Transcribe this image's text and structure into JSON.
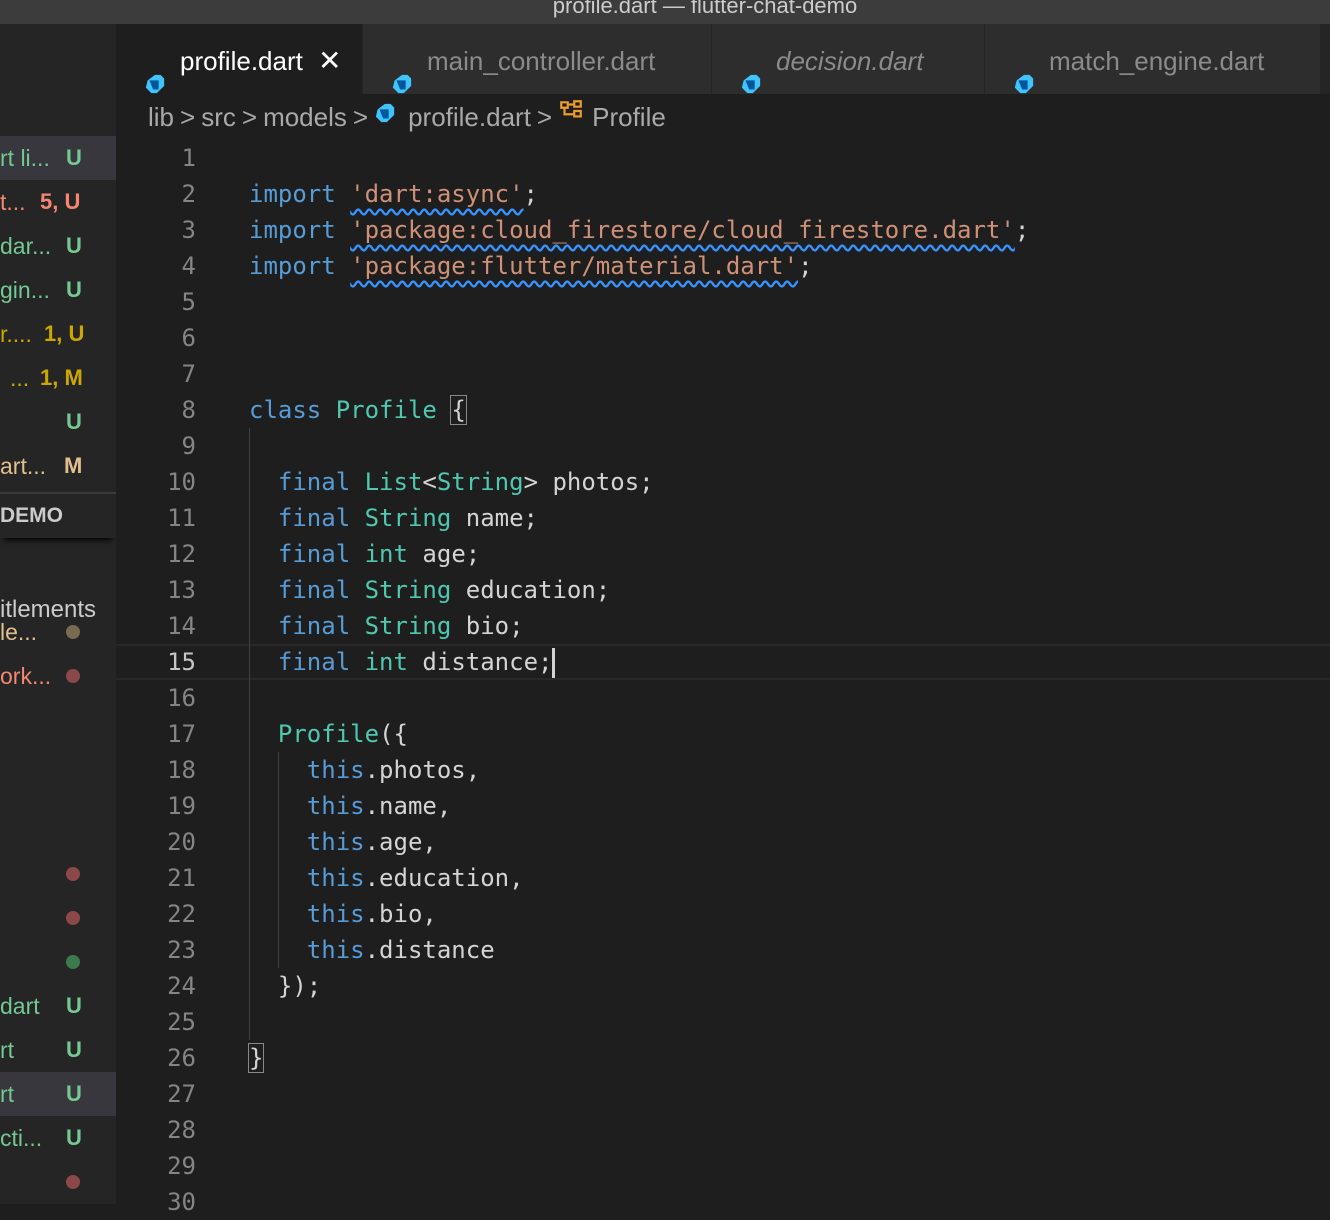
{
  "window": {
    "title": "profile.dart — flutter-chat-demo"
  },
  "colors": {
    "keyword": "#569cd6",
    "type": "#4ec9b0",
    "string": "#ce9178",
    "text": "#d4d4d4",
    "untracked": "#73c991",
    "modified": "#e2c08d",
    "error": "#f48771"
  },
  "sidebar": {
    "items": [
      {
        "name": "rt li...",
        "badge": "U",
        "color": "#73c991"
      },
      {
        "name": "t...",
        "badge": "5, U",
        "color": "#f48771"
      },
      {
        "name": "dar...",
        "badge": "U",
        "color": "#73c991"
      },
      {
        "name": "gin...",
        "badge": "U",
        "color": "#73c991"
      },
      {
        "name": "r....",
        "badge": "1, U",
        "color": "#cca700"
      },
      {
        "name": "...",
        "badge": "1, M",
        "color": "#cca700"
      },
      {
        "name": "",
        "badge": "U",
        "color": "#73c991"
      },
      {
        "name": "art...",
        "badge": "M",
        "color": "#e2c08d"
      }
    ],
    "section_header": "DEMO",
    "entitlements": "itlements",
    "dot_items": [
      {
        "name": "le...",
        "color": "#7a6a50"
      },
      {
        "name": "ork...",
        "color": "#8c4848"
      }
    ],
    "bottom_items": [
      {
        "name": "dart",
        "badge": "U"
      },
      {
        "name": "rt",
        "badge": "U"
      },
      {
        "name": "rt",
        "badge": "U"
      },
      {
        "name": "cti...",
        "badge": "U"
      }
    ]
  },
  "tabs": [
    {
      "label": "profile.dart",
      "close": "✕"
    },
    {
      "label": "main_controller.dart"
    },
    {
      "label": "decision.dart"
    },
    {
      "label": "match_engine.dart"
    }
  ],
  "breadcrumb": {
    "items": [
      "lib",
      "src",
      "models",
      "profile.dart",
      "Profile"
    ],
    "separator": ">"
  },
  "editor": {
    "lines": [
      [],
      [
        [
          "kw",
          "import"
        ],
        [
          "txt",
          " "
        ],
        [
          "str",
          "'dart:async'"
        ],
        [
          "txt",
          ";"
        ]
      ],
      [
        [
          "kw",
          "import"
        ],
        [
          "txt",
          " "
        ],
        [
          "str",
          "'package:cloud_firestore/cloud_firestore.dart'"
        ],
        [
          "txt",
          ";"
        ]
      ],
      [
        [
          "kw",
          "import"
        ],
        [
          "txt",
          " "
        ],
        [
          "str",
          "'package:flutter/material.dart'"
        ],
        [
          "txt",
          ";"
        ]
      ],
      [],
      [],
      [],
      [
        [
          "kw",
          "class"
        ],
        [
          "txt",
          " "
        ],
        [
          "type",
          "Profile"
        ],
        [
          "txt",
          " "
        ],
        [
          "brk",
          "{"
        ]
      ],
      [],
      [
        [
          "txt",
          "  "
        ],
        [
          "kw",
          "final"
        ],
        [
          "txt",
          " "
        ],
        [
          "type",
          "List"
        ],
        [
          "txt",
          "<"
        ],
        [
          "type",
          "String"
        ],
        [
          "txt",
          "> photos;"
        ]
      ],
      [
        [
          "txt",
          "  "
        ],
        [
          "kw",
          "final"
        ],
        [
          "txt",
          " "
        ],
        [
          "type",
          "String"
        ],
        [
          "txt",
          " name;"
        ]
      ],
      [
        [
          "txt",
          "  "
        ],
        [
          "kw",
          "final"
        ],
        [
          "txt",
          " "
        ],
        [
          "type",
          "int"
        ],
        [
          "txt",
          " age;"
        ]
      ],
      [
        [
          "txt",
          "  "
        ],
        [
          "kw",
          "final"
        ],
        [
          "txt",
          " "
        ],
        [
          "type",
          "String"
        ],
        [
          "txt",
          " education;"
        ]
      ],
      [
        [
          "txt",
          "  "
        ],
        [
          "kw",
          "final"
        ],
        [
          "txt",
          " "
        ],
        [
          "type",
          "String"
        ],
        [
          "txt",
          " bio;"
        ]
      ],
      [
        [
          "txt",
          "  "
        ],
        [
          "kw",
          "final"
        ],
        [
          "txt",
          " "
        ],
        [
          "type",
          "int"
        ],
        [
          "txt",
          " distance;"
        ],
        [
          "cursor",
          ""
        ]
      ],
      [],
      [
        [
          "txt",
          "  "
        ],
        [
          "type",
          "Profile"
        ],
        [
          "txt",
          "({"
        ]
      ],
      [
        [
          "txt",
          "    "
        ],
        [
          "kw",
          "this"
        ],
        [
          "txt",
          ".photos,"
        ]
      ],
      [
        [
          "txt",
          "    "
        ],
        [
          "kw",
          "this"
        ],
        [
          "txt",
          ".name,"
        ]
      ],
      [
        [
          "txt",
          "    "
        ],
        [
          "kw",
          "this"
        ],
        [
          "txt",
          ".age,"
        ]
      ],
      [
        [
          "txt",
          "    "
        ],
        [
          "kw",
          "this"
        ],
        [
          "txt",
          ".education,"
        ]
      ],
      [
        [
          "txt",
          "    "
        ],
        [
          "kw",
          "this"
        ],
        [
          "txt",
          ".bio,"
        ]
      ],
      [
        [
          "txt",
          "    "
        ],
        [
          "kw",
          "this"
        ],
        [
          "txt",
          ".distance"
        ]
      ],
      [
        [
          "txt",
          "  });"
        ]
      ],
      [],
      [
        [
          "brk",
          "}"
        ]
      ],
      [],
      [],
      [],
      []
    ],
    "line_numbers": [
      "1",
      "2",
      "3",
      "4",
      "5",
      "6",
      "7",
      "8",
      "9",
      "10",
      "11",
      "12",
      "13",
      "14",
      "15",
      "16",
      "17",
      "18",
      "19",
      "20",
      "21",
      "22",
      "23",
      "24",
      "25",
      "26",
      "27",
      "28",
      "29",
      "30"
    ],
    "current_line": 15
  }
}
